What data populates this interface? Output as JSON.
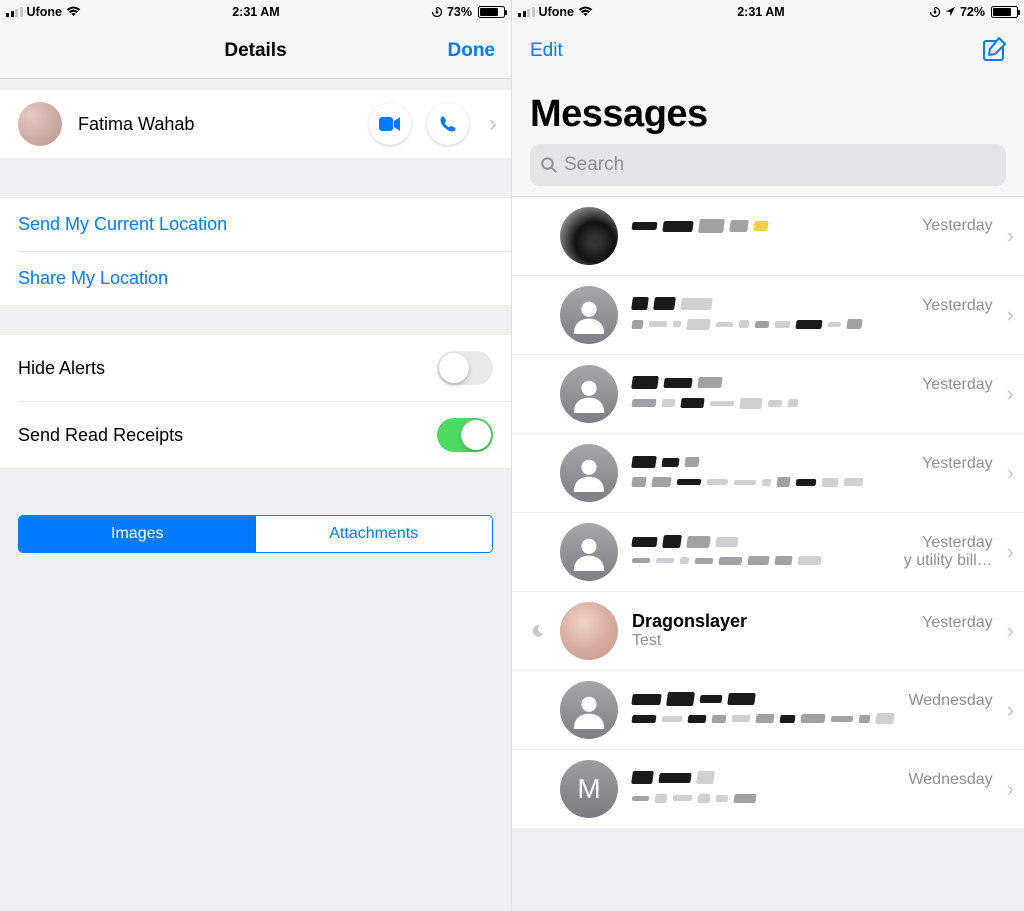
{
  "left": {
    "status": {
      "carrier": "Ufone",
      "time": "2:31 AM",
      "battery_pct": "73%",
      "batt_fill": 73,
      "show_location": false
    },
    "nav": {
      "title": "Details",
      "done": "Done"
    },
    "contact": {
      "name": "Fatima Wahab"
    },
    "location": {
      "send": "Send My Current Location",
      "share": "Share My Location"
    },
    "toggles": {
      "hide_alerts": "Hide Alerts",
      "read_receipts": "Send Read Receipts",
      "hide_alerts_on": false,
      "read_receipts_on": true
    },
    "seg": {
      "images": "Images",
      "attachments": "Attachments"
    }
  },
  "right": {
    "status": {
      "carrier": "Ufone",
      "time": "2:31 AM",
      "battery_pct": "72%",
      "batt_fill": 72,
      "show_location": true
    },
    "nav": {
      "edit": "Edit",
      "title": "Messages"
    },
    "search": {
      "placeholder": "Search"
    },
    "convos": [
      {
        "name_redacted": true,
        "avatar": "dark",
        "time": "Yesterday",
        "preview": ""
      },
      {
        "name_redacted": true,
        "avatar": "sil",
        "time": "Yesterday",
        "preview_redacted": true
      },
      {
        "name_redacted": true,
        "avatar": "sil",
        "time": "Yesterday",
        "preview_redacted": true
      },
      {
        "name_redacted": true,
        "avatar": "sil",
        "time": "Yesterday",
        "preview_redacted": true
      },
      {
        "name_redacted": true,
        "avatar": "sil",
        "time": "Yesterday",
        "preview": "y utility bill…",
        "preview_redacted": true
      },
      {
        "name": "Dragonslayer",
        "avatar": "photo",
        "time": "Yesterday",
        "preview": "Test",
        "muted": true,
        "bold": true
      },
      {
        "name_redacted": true,
        "avatar": "sil",
        "time": "Wednesday",
        "preview_redacted": true
      },
      {
        "name_redacted": true,
        "avatar": "letter",
        "letter": "M",
        "time": "Wednesday",
        "preview_redacted": true
      }
    ]
  }
}
